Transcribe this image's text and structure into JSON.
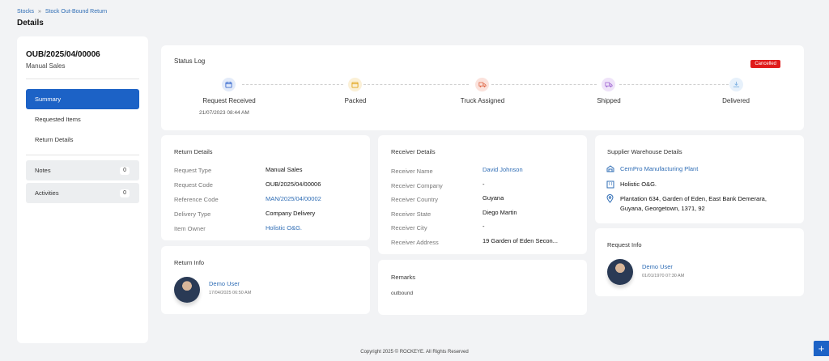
{
  "breadcrumb": {
    "root": "Stocks",
    "separator": "»",
    "current": "Stock Out-Bound Return"
  },
  "page_title": "Details",
  "left": {
    "code": "OUB/2025/04/00006",
    "subtitle": "Manual Sales",
    "nav": [
      {
        "label": "Summary",
        "active": true
      },
      {
        "label": "Requested Items"
      },
      {
        "label": "Return Details"
      }
    ],
    "extras": [
      {
        "label": "Notes",
        "count": "0"
      },
      {
        "label": "Activities",
        "count": "0"
      }
    ]
  },
  "status_log": {
    "title": "Status Log",
    "badge": "Cancelled",
    "steps": [
      {
        "label": "Request Received",
        "date": "21/07/2023 08:44 AM",
        "icon": "calendar-icon",
        "color": "#3f6fd0",
        "bg": "#e3ebf9"
      },
      {
        "label": "Packed",
        "icon": "box-icon",
        "color": "#e2a41a",
        "bg": "#fbf0d6"
      },
      {
        "label": "Truck Assigned",
        "icon": "truck-icon",
        "color": "#e06b4a",
        "bg": "#fbe2dc"
      },
      {
        "label": "Shipped",
        "icon": "truck-icon",
        "color": "#a26bd3",
        "bg": "#efe3f9"
      },
      {
        "label": "Delivered",
        "icon": "download-icon",
        "color": "#7fb1e2",
        "bg": "#e7f1fb"
      }
    ]
  },
  "return_details": {
    "title": "Return Details",
    "rows": [
      {
        "key": "Request Type",
        "value": "Manual Sales",
        "link": false
      },
      {
        "key": "Request Code",
        "value": "OUB/2025/04/00006",
        "link": false
      },
      {
        "key": "Reference Code",
        "value": "MAN/2025/04/00002",
        "link": true
      },
      {
        "key": "Delivery Type",
        "value": "Company Delivery",
        "link": false
      },
      {
        "key": "Item Owner",
        "value": "Holistic O&G.",
        "link": true
      }
    ]
  },
  "receiver_details": {
    "title": "Receiver Details",
    "rows": [
      {
        "key": "Receiver Name",
        "value": "David Johnson",
        "link": true
      },
      {
        "key": "Receiver Company",
        "value": "-",
        "link": false
      },
      {
        "key": "Receiver Country",
        "value": "Guyana",
        "link": false
      },
      {
        "key": "Receiver State",
        "value": "Diego Martin",
        "link": false
      },
      {
        "key": "Receiver City",
        "value": "-",
        "link": false
      },
      {
        "key": "Receiver Address",
        "value": "19 Garden of Eden Secon...",
        "link": false
      }
    ]
  },
  "supplier": {
    "title": "Supplier Warehouse Details",
    "warehouse": "CemPro Manufacturing Plant",
    "company": "Holistic O&G.",
    "address_line1": "Plantation 634, Garden of Eden, East Bank Demerara,",
    "address_line2": "Guyana, Georgetown, 1371, 92"
  },
  "return_info": {
    "title": "Return Info",
    "user": "Demo User",
    "date": "17/04/2025 06:50 AM"
  },
  "remarks": {
    "title": "Remarks",
    "text": "outbound"
  },
  "request_info": {
    "title": "Request Info",
    "user": "Demo User",
    "date": "01/01/1970 07:30 AM"
  },
  "footer": "Copyright 2025 © ROCKEYE. All Rights Reserved",
  "fab": "+"
}
